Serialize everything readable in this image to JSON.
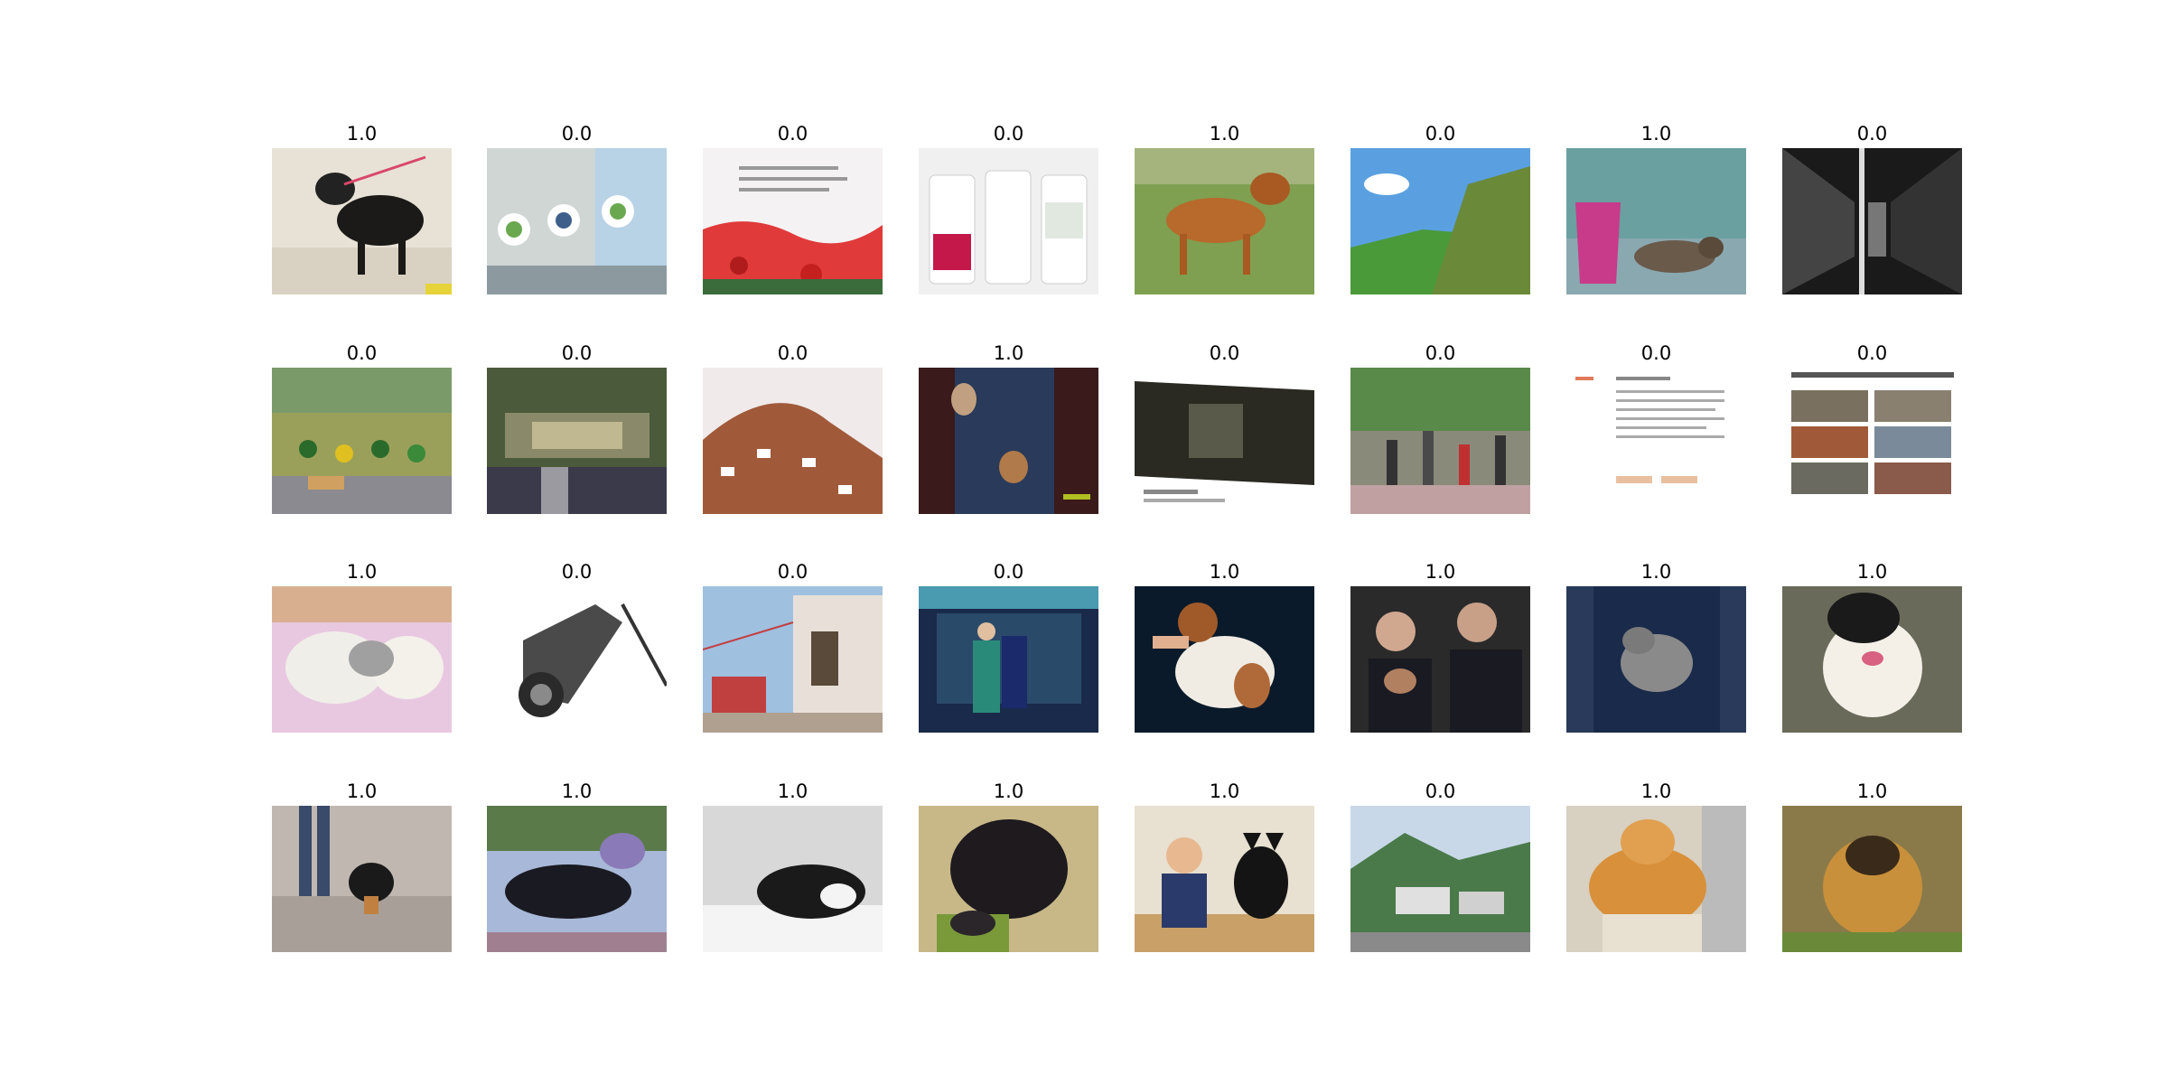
{
  "figure": {
    "rows": [
      {
        "cells": [
          {
            "label": "1.0",
            "scene": "dog-standing-on-tiles"
          },
          {
            "label": "0.0",
            "scene": "signboards-with-logos"
          },
          {
            "label": "0.0",
            "scene": "red-flowers-with-text"
          },
          {
            "label": "0.0",
            "scene": "mobile-app-screens"
          },
          {
            "label": "1.0",
            "scene": "brown-dog-on-grass"
          },
          {
            "label": "0.0",
            "scene": "green-hill-landscape"
          },
          {
            "label": "1.0",
            "scene": "cat-on-porch"
          },
          {
            "label": "0.0",
            "scene": "dark-alley"
          }
        ]
      },
      {
        "cells": [
          {
            "label": "0.0",
            "scene": "people-in-field"
          },
          {
            "label": "0.0",
            "scene": "aerial-buildings"
          },
          {
            "label": "0.0",
            "scene": "hillside-village"
          },
          {
            "label": "1.0",
            "scene": "cat-behind-door"
          },
          {
            "label": "0.0",
            "scene": "social-post-alley"
          },
          {
            "label": "0.0",
            "scene": "street-with-people"
          },
          {
            "label": "0.0",
            "scene": "text-document"
          },
          {
            "label": "0.0",
            "scene": "photo-collage-document"
          }
        ]
      },
      {
        "cells": [
          {
            "label": "1.0",
            "scene": "two-white-cats"
          },
          {
            "label": "0.0",
            "scene": "vintage-camera"
          },
          {
            "label": "0.0",
            "scene": "village-street"
          },
          {
            "label": "0.0",
            "scene": "convenience-store-front"
          },
          {
            "label": "1.0",
            "scene": "held-white-dog"
          },
          {
            "label": "1.0",
            "scene": "women-with-cat"
          },
          {
            "label": "1.0",
            "scene": "person-holding-cat"
          },
          {
            "label": "1.0",
            "scene": "black-white-dog"
          }
        ]
      },
      {
        "cells": [
          {
            "label": "1.0",
            "scene": "small-black-dog-indoors"
          },
          {
            "label": "1.0",
            "scene": "black-puppy-lying"
          },
          {
            "label": "1.0",
            "scene": "black-white-cat-on-bed"
          },
          {
            "label": "1.0",
            "scene": "black-fluffy-puppy"
          },
          {
            "label": "1.0",
            "scene": "boy-with-black-dog"
          },
          {
            "label": "0.0",
            "scene": "mountain-village"
          },
          {
            "label": "1.0",
            "scene": "orange-cat"
          },
          {
            "label": "1.0",
            "scene": "fluffy-dog-in-cage"
          }
        ]
      }
    ]
  }
}
